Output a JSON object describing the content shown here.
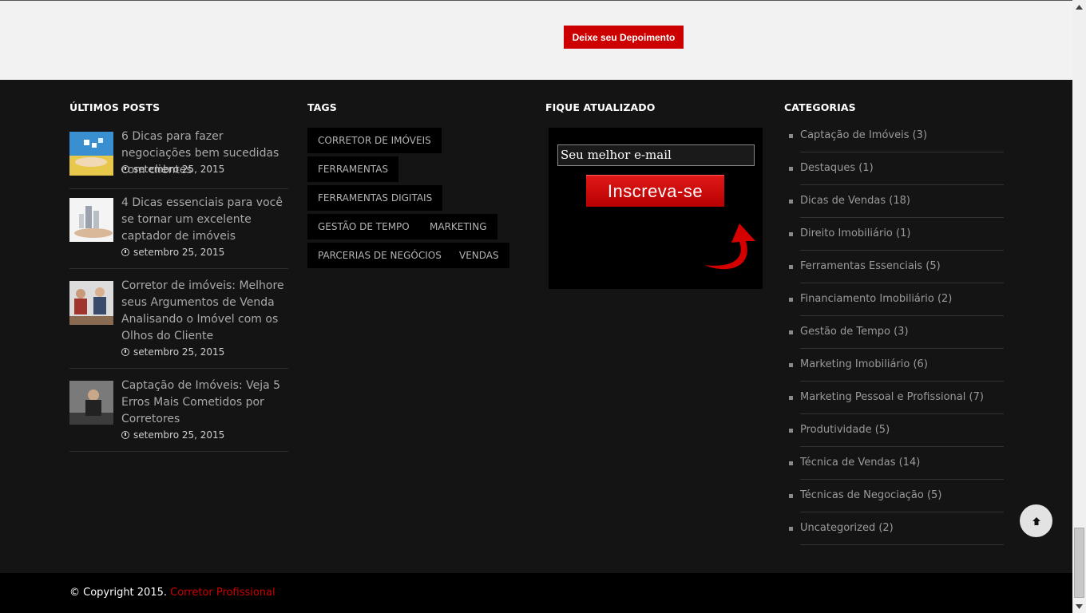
{
  "top_band": {
    "depoimento_label": "Deixe seu Depoimento"
  },
  "footer": {
    "posts": {
      "title": "ÚLTIMOS POSTS",
      "items": [
        {
          "title": "6 Dicas para fazer negociações bem sucedidas com clientes",
          "date": "setembro 25, 2015"
        },
        {
          "title": "4 Dicas essenciais para você se tornar um excelente captador de imóveis",
          "date": "setembro 25, 2015"
        },
        {
          "title": "Corretor de imóveis: Melhore seus Argumentos de Venda Analisando o Imóvel com os Olhos do Cliente",
          "date": "setembro 25, 2015"
        },
        {
          "title": "Captação de Imóveis: Veja 5 Erros Mais Cometidos por Corretores",
          "date": "setembro 25, 2015"
        }
      ]
    },
    "tags": {
      "title": "TAGS",
      "items": [
        "CORRETOR DE IMÓVEIS",
        "FERRAMENTAS",
        "FERRAMENTAS DIGITAIS",
        "GESTÃO DE TEMPO",
        "MARKETING",
        "PARCERIAS DE NEGÓCIOS",
        "VENDAS"
      ]
    },
    "newsletter": {
      "title": "FIQUE ATUALIZADO",
      "email_value": "Seu melhor e-mail",
      "subscribe_label": "Inscreva-se"
    },
    "categories": {
      "title": "CATEGORIAS",
      "items": [
        "Captação de Imóveis (3)",
        "Destaques (1)",
        "Dicas de Vendas (18)",
        "Direito Imobiliário (1)",
        "Ferramentas Essenciais (5)",
        "Financiamento Imobiliário (2)",
        "Gestão de Tempo (3)",
        "Marketing Imobiliário (6)",
        "Marketing Pessoal e Profissional (7)",
        "Produtividade (5)",
        "Técnica de Vendas (14)",
        "Técnicas de Negociação (5)",
        "Uncategorized (2)"
      ]
    }
  },
  "bottom_bar": {
    "copyright": "© Copyright 2015.",
    "site_link": "Corretor Profissional"
  },
  "colors": {
    "accent": "#cc0000",
    "footer_bg": "#141414",
    "top_bg": "#f2f2f2"
  },
  "icons": [
    "clock-icon",
    "arrow-up-icon",
    "curved-arrow-icon"
  ]
}
